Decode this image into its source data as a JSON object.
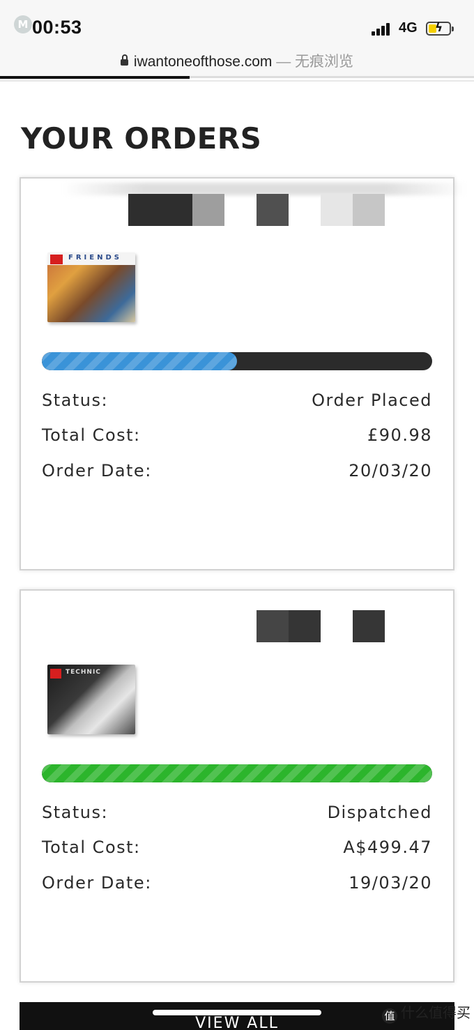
{
  "status_bar": {
    "time": "00:53",
    "network": "4G",
    "app_badge": "M"
  },
  "browser": {
    "domain": "iwantoneofthose.com",
    "mode_suffix": " — 无痕浏览"
  },
  "page": {
    "title": "YOUR ORDERS"
  },
  "orders": [
    {
      "product_brand": "FRIENDS",
      "progress": 0.5,
      "progress_color": "#3a93d8",
      "status_label": "Status:",
      "status": "Order Placed",
      "cost_label": "Total Cost:",
      "total_cost": "£90.98",
      "date_label": "Order Date:",
      "order_date": "20/03/20"
    },
    {
      "product_brand": "TECHNIC",
      "progress": 1.0,
      "progress_color": "#2cb52c",
      "status_label": "Status:",
      "status": "Dispatched",
      "cost_label": "Total Cost:",
      "total_cost": "A$499.47",
      "date_label": "Order Date:",
      "order_date": "19/03/20"
    }
  ],
  "footer": {
    "view_all_label": "VIEW ALL"
  },
  "watermark": {
    "logo": "值",
    "text": "什么值得买"
  }
}
